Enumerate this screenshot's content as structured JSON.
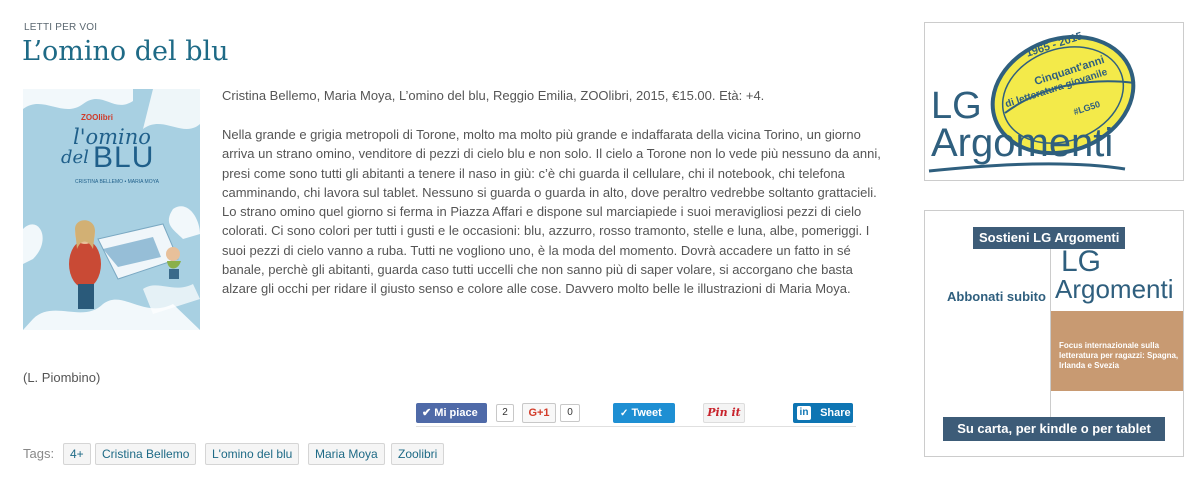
{
  "article": {
    "category": "LETTI PER VOI",
    "title": "L’omino del blu",
    "citation": "Cristina Bellemo, Maria Moya, L’omino del blu, Reggio Emilia, ZOOlibri, 2015, €15.00. Età: +4.",
    "body": "Nella grande e grigia metropoli di Torone, molto ma molto più grande e indaffarata della vicina Torino, un giorno arriva un strano omino, venditore di pezzi di cielo blu e non solo. Il cielo a Torone non lo vede più nessuno da anni, presi come sono tutti gli abitanti a tenere il naso in giù: c’è chi guarda il cellulare, chi il notebook, chi telefona camminando, chi lavora sul tablet. Nessuno si guarda o guarda in alto, dove peraltro vedrebbe soltanto grattacieli. Lo strano omino quel giorno si ferma in Piazza Affari e dispone sul marciapiede i suoi meravigliosi pezzi di cielo colorati. Ci sono colori per tutti i gusti  e le occasioni: blu, azzurro, rosso tramonto, stelle e luna, albe, pomeriggi. I suoi pezzi di cielo vanno a ruba. Tutti ne vogliono uno, è la moda del momento. Dovrà accadere un fatto in sé banale, perchè gli abitanti, guarda caso tutti uccelli che non sanno più di saper volare, si accorgano che basta alzare gli occhi per ridare il giusto senso e colore alle cose. Davvero molto belle le illustrazioni di Maria Moya.",
    "author": "(L. Piombino)"
  },
  "cover": {
    "publisher": "ZOOlibri",
    "title_line1": "l'omino",
    "title_line2": "del",
    "title_line3": "BLU",
    "authors": "CRISTINA BELLEMO • MARIA MOYA"
  },
  "share": {
    "facebook_label": "Mi piace",
    "facebook_count": "2",
    "gplus_label": "G+1",
    "gplus_count": "0",
    "twitter_label": "Tweet",
    "pinterest_label": "Pin it",
    "linkedin_label": "Share"
  },
  "tags": {
    "label": "Tags:",
    "items": [
      "4+",
      "Cristina Bellemo",
      "L'omino del blu",
      "Maria Moya",
      "Zoolibri"
    ]
  },
  "ad1": {
    "badge_years": "1965 - 2015",
    "badge_line1": "Cinquant'anni",
    "badge_line2": "di letteratura giovanile",
    "badge_seal": "#LG50",
    "logo_line1": "LG",
    "logo_line2": "Argomenti"
  },
  "ad2": {
    "header": "Sostieni LG Argomenti",
    "subscribe": "Abbonati subito",
    "magazine_logo1": "LG",
    "magazine_logo2": "Argomenti",
    "magazine_headline": "Focus internazionale sulla letteratura per ragazzi: Spagna, Irlanda e Svezia",
    "footer": "Su carta, per kindle o per tablet"
  },
  "colors": {
    "accent": "#1e6a86",
    "facebook": "#4f6aa8",
    "twitter": "#1e8fd3",
    "linkedin": "#0e75b3",
    "ad_banner": "#3d5c78"
  }
}
